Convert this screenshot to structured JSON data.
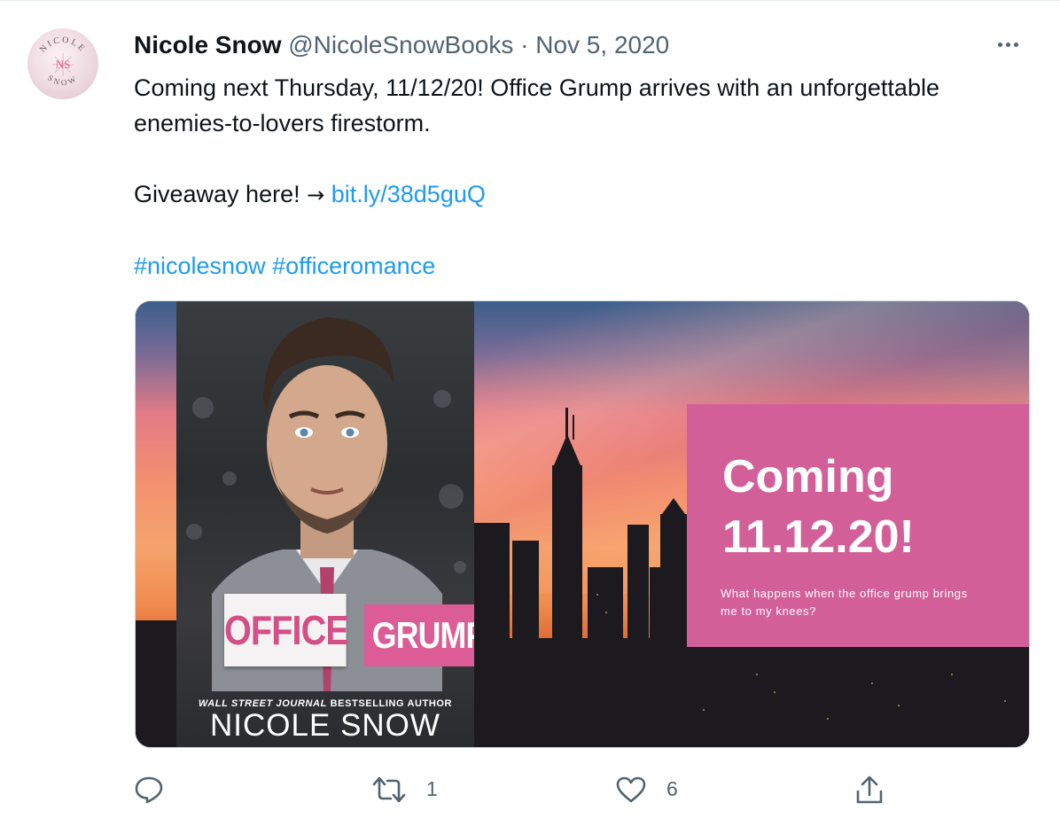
{
  "tweet": {
    "author": {
      "display_name": "Nicole Snow",
      "handle": "@NicoleSnowBooks",
      "separator": "·",
      "date": "Nov 5, 2020",
      "avatar_text_top": "NICOLE",
      "avatar_monogram": "NS",
      "avatar_text_bottom": "SNOW"
    },
    "text": {
      "line1": "Coming next Thursday, 11/12/20! Office Grump arrives with an unforgettable enemies-to-lovers firestorm.",
      "giveaway_prefix": "Giveaway here!",
      "giveaway_arrow": "→",
      "link": "bit.ly/38d5guQ",
      "hashtag1": "#nicolesnow",
      "hashtag2": "#officeromance"
    },
    "media": {
      "cover_title_1": "OFFICE",
      "cover_title_2": "GRUMP",
      "cover_tagline_italic": "WALL STREET JOURNAL",
      "cover_tagline_rest": "BESTSELLING AUTHOR",
      "cover_author": "NICOLE SNOW",
      "promo_line1": "Coming",
      "promo_line2": "11.12.20!",
      "promo_subtext": "What happens when the office grump brings me to my knees?"
    },
    "actions": {
      "reply_icon": "reply-icon",
      "retweet_icon": "retweet-icon",
      "retweet_count": "1",
      "like_icon": "heart-icon",
      "like_count": "6",
      "share_icon": "share-icon"
    },
    "colors": {
      "link": "#1d9bf0",
      "secondary_text": "#536471",
      "promo_pink": "#d35f99"
    }
  }
}
